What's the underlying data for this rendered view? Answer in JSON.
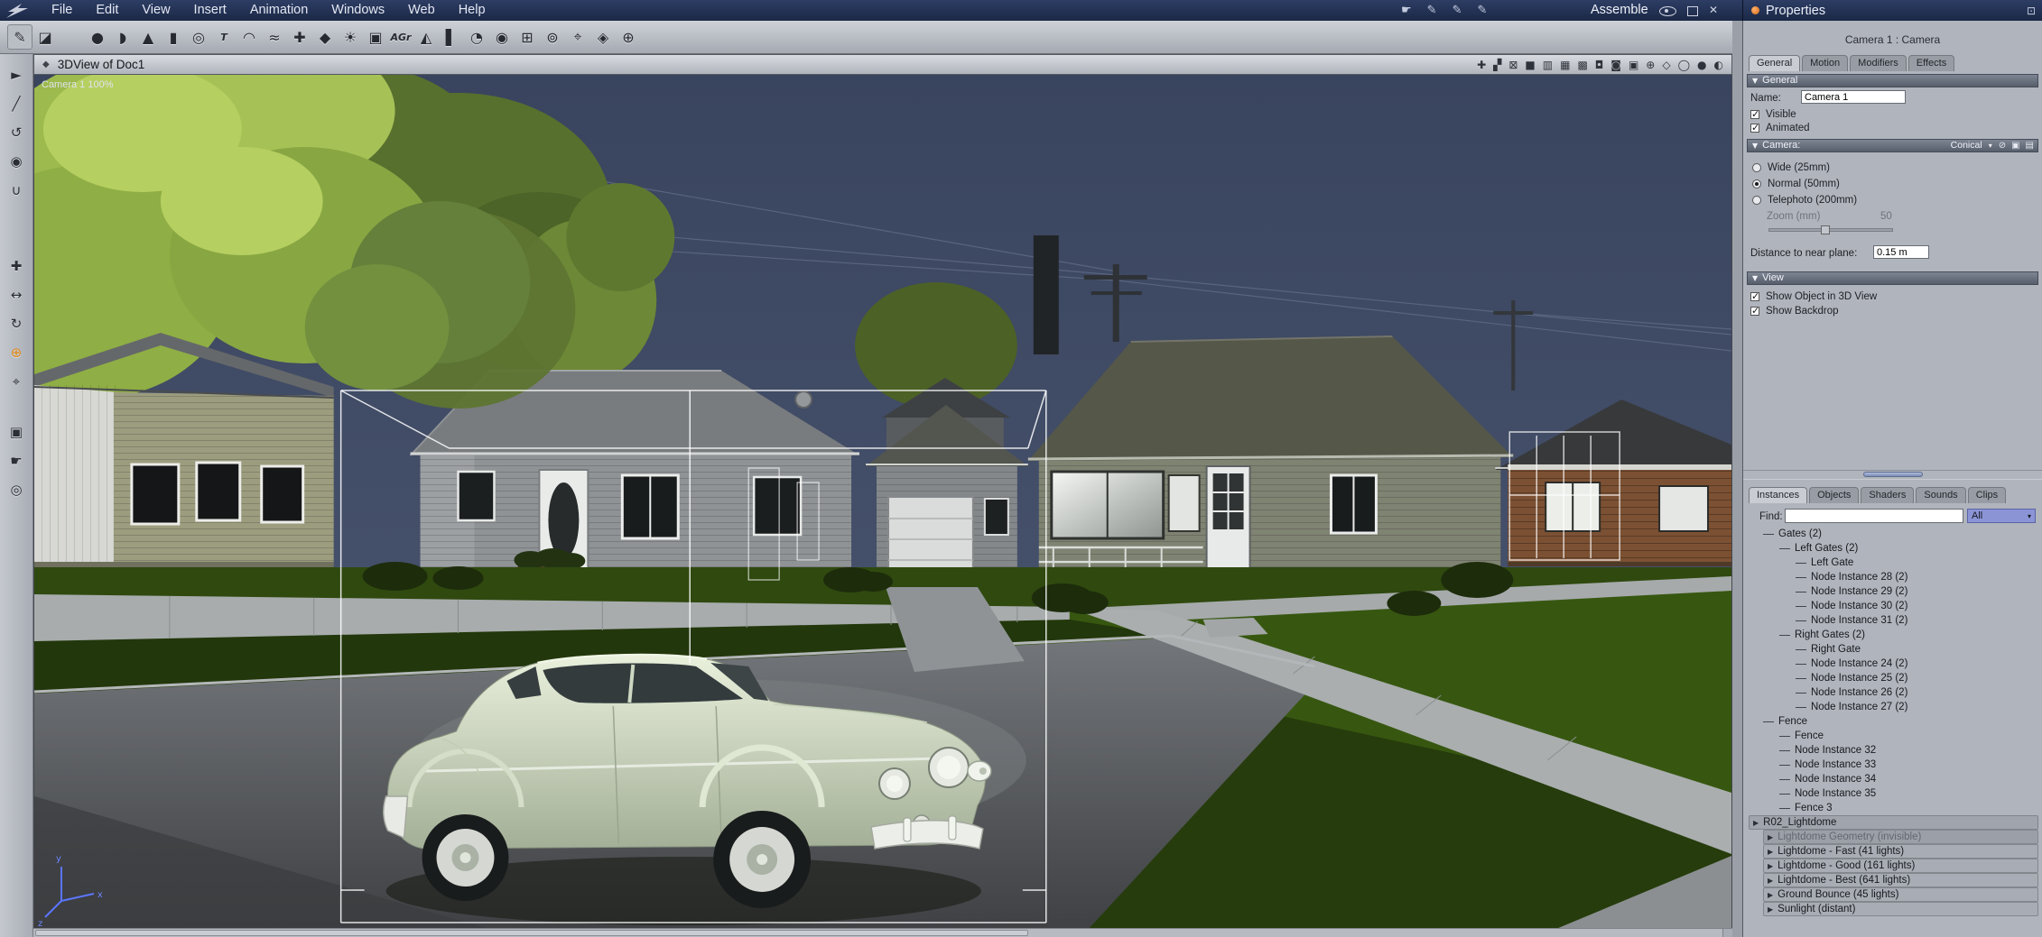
{
  "menu": {
    "items": [
      "File",
      "Edit",
      "View",
      "Insert",
      "Animation",
      "Windows",
      "Web",
      "Help"
    ],
    "right_icons": [
      {
        "g": "☛",
        "name": "pointer-mode-icon"
      },
      {
        "g": "✎",
        "name": "pen-mode-icon"
      },
      {
        "g": "✎",
        "name": "pen-mode-2-icon"
      },
      {
        "g": "✎",
        "name": "pen-mode-3-icon"
      }
    ],
    "mode_label": "Assemble"
  },
  "toolbar": {
    "icons": [
      {
        "g": "✎",
        "name": "paint-tool-icon"
      },
      {
        "g": "◪",
        "name": "uv-tool-icon"
      },
      {
        "g": "●",
        "name": "sphere-primitive-icon"
      },
      {
        "g": "◗",
        "name": "capsule-primitive-icon"
      },
      {
        "g": "▲",
        "name": "cone-primitive-icon"
      },
      {
        "g": "▮",
        "name": "cube-primitive-icon"
      },
      {
        "g": "◎",
        "name": "torus-primitive-icon"
      },
      {
        "g": "T",
        "name": "text-object-icon",
        "cls": "txt"
      },
      {
        "g": "◠",
        "name": "arc-tool-icon"
      },
      {
        "g": "≈",
        "name": "spline-tool-icon"
      },
      {
        "g": "✚",
        "name": "lattice-tool-icon"
      },
      {
        "g": "◆",
        "name": "vertex-tool-icon"
      },
      {
        "g": "☀",
        "name": "light-object-icon"
      },
      {
        "g": "▣",
        "name": "camera-object-icon"
      },
      {
        "g": "AGr",
        "name": "animation-graph-icon",
        "cls": "txt"
      },
      {
        "g": "◭",
        "name": "terrain-object-icon"
      },
      {
        "g": "▌",
        "name": "backdrop-object-icon"
      },
      {
        "g": "◔",
        "name": "time-icon"
      },
      {
        "g": "◉",
        "name": "target-object-icon"
      },
      {
        "g": "⊞",
        "name": "grid-object-icon"
      },
      {
        "g": "⊚",
        "name": "ring-object-icon"
      },
      {
        "g": "⌖",
        "name": "locator-object-icon"
      },
      {
        "g": "◈",
        "name": "gem-object-icon"
      },
      {
        "g": "⊕",
        "name": "axis-object-icon"
      }
    ]
  },
  "left_toolbar": {
    "icons": [
      {
        "g": "►",
        "name": "select-tool-icon"
      },
      {
        "g": "╱",
        "name": "knife-tool-icon"
      },
      {
        "g": "↺",
        "name": "undo-view-icon"
      },
      {
        "g": "◉",
        "name": "pin-tool-icon"
      },
      {
        "g": "∪",
        "name": "magnet-tool-icon"
      },
      {
        "g": "✚",
        "name": "move-tool-icon"
      },
      {
        "g": "↔",
        "name": "scale-tool-icon"
      },
      {
        "g": "↻",
        "name": "rotate-tool-icon"
      },
      {
        "g": "⊕",
        "name": "universal-manipulator-icon",
        "cls": "accent"
      },
      {
        "g": "⌖",
        "name": "target-tool-icon"
      },
      {
        "g": "▣",
        "name": "camera-view-icon"
      },
      {
        "g": "☛",
        "name": "pan-tool-icon"
      },
      {
        "g": "◎",
        "name": "zoom-tool-icon"
      }
    ]
  },
  "viewport": {
    "title": "3DView of Doc1",
    "camera_label": "Camera 1 100%",
    "header_icons": [
      {
        "g": "✚",
        "name": "crosshair-icon"
      },
      {
        "g": "▞",
        "name": "pattern-icon"
      },
      {
        "g": "⊠",
        "name": "bounds-icon"
      },
      {
        "g": "■",
        "name": "layout-single-icon"
      },
      {
        "g": "▥",
        "name": "layout-columns-icon"
      },
      {
        "g": "▦",
        "name": "layout-grid-icon"
      },
      {
        "g": "▩",
        "name": "layout-quad-icon"
      },
      {
        "g": "◘",
        "name": "shade-flat-icon"
      },
      {
        "g": "◙",
        "name": "shade-full-icon"
      },
      {
        "g": "▣",
        "name": "shade-box-icon"
      },
      {
        "g": "⊕",
        "name": "axis-toggle-icon"
      },
      {
        "g": "◇",
        "name": "wire-toggle-icon"
      },
      {
        "g": "◯",
        "name": "render-wire-icon"
      },
      {
        "g": "●",
        "name": "render-solid-icon"
      },
      {
        "g": "◐",
        "name": "render-shaded-icon"
      }
    ]
  },
  "properties": {
    "title": "Properties",
    "context_label": "Camera 1 : Camera",
    "collapse_arrow": "▼",
    "tabs": [
      {
        "label": "General",
        "state": "active"
      },
      {
        "label": "Motion"
      },
      {
        "label": "Modifiers"
      },
      {
        "label": "Effects"
      }
    ],
    "general": {
      "header": "General",
      "name_label": "Name:",
      "name_value": "Camera 1",
      "checkboxes": [
        {
          "label": "Visible",
          "state": "checked"
        },
        {
          "label": "Animated",
          "state": "checked"
        }
      ]
    },
    "camera": {
      "header": "Camera:",
      "projection": "Conical",
      "bar_icons": [
        {
          "g": "⊘",
          "name": "disable-icon"
        },
        {
          "g": "▣",
          "name": "chip-icon"
        },
        {
          "g": "▤",
          "name": "options-icon"
        }
      ],
      "radios": [
        {
          "label": "Wide (25mm)"
        },
        {
          "label": "Normal (50mm)",
          "state": "selected"
        },
        {
          "label": "Telephoto (200mm)"
        }
      ],
      "zoom_label": "Zoom (mm)",
      "zoom_value": "50",
      "near_label": "Distance to near plane:",
      "near_value": "0.15 m"
    },
    "view": {
      "header": "View",
      "checkboxes": [
        {
          "label": "Show Object in 3D View",
          "state": "checked"
        },
        {
          "label": "Show Backdrop",
          "state": "checked"
        }
      ]
    }
  },
  "browser": {
    "tabs": [
      {
        "label": "Instances",
        "state": "active"
      },
      {
        "label": "Objects"
      },
      {
        "label": "Shaders"
      },
      {
        "label": "Sounds"
      },
      {
        "label": "Clips"
      }
    ],
    "find_label": "Find:",
    "find_value": "",
    "filter_value": "All",
    "tree": [
      {
        "label": "Gates (2)",
        "ind": "ind1",
        "kind": "plain"
      },
      {
        "label": "Left Gates (2)",
        "ind": "ind2",
        "kind": "plain"
      },
      {
        "label": "Left Gate",
        "ind": "ind3",
        "kind": "plain"
      },
      {
        "label": "Node Instance 28 (2)",
        "ind": "ind3",
        "kind": "plain"
      },
      {
        "label": "Node Instance 29 (2)",
        "ind": "ind3",
        "kind": "plain"
      },
      {
        "label": "Node Instance 30 (2)",
        "ind": "ind3",
        "kind": "plain"
      },
      {
        "label": "Node Instance 31 (2)",
        "ind": "ind3",
        "kind": "plain"
      },
      {
        "label": "Right Gates (2)",
        "ind": "ind2",
        "kind": "plain"
      },
      {
        "label": "Right Gate",
        "ind": "ind3",
        "kind": "plain"
      },
      {
        "label": "Node Instance 24 (2)",
        "ind": "ind3",
        "kind": "plain"
      },
      {
        "label": "Node Instance 25 (2)",
        "ind": "ind3",
        "kind": "plain"
      },
      {
        "label": "Node Instance 26 (2)",
        "ind": "ind3",
        "kind": "plain"
      },
      {
        "label": "Node Instance 27 (2)",
        "ind": "ind3",
        "kind": "plain"
      },
      {
        "label": "Fence",
        "ind": "ind1",
        "kind": "plain"
      },
      {
        "label": "Fence",
        "ind": "ind2",
        "kind": "plain"
      },
      {
        "label": "Node Instance 32",
        "ind": "ind2",
        "kind": "plain"
      },
      {
        "label": "Node Instance 33",
        "ind": "ind2",
        "kind": "plain"
      },
      {
        "label": "Node Instance 34",
        "ind": "ind2",
        "kind": "plain"
      },
      {
        "label": "Node Instance 35",
        "ind": "ind2",
        "kind": "plain"
      },
      {
        "label": "Fence 3",
        "ind": "ind2",
        "kind": "plain"
      },
      {
        "label": "R02_Lightdome",
        "ind": "ind0",
        "kind": "group"
      },
      {
        "label": "Lightdome Geometry (invisible)",
        "ind": "ind1",
        "kind": "dim"
      },
      {
        "label": "Lightdome - Fast (41 lights)",
        "ind": "ind1",
        "kind": "light"
      },
      {
        "label": "Lightdome - Good (161 lights)",
        "ind": "ind1",
        "kind": "light"
      },
      {
        "label": "Lightdome - Best (641 lights)",
        "ind": "ind1",
        "kind": "light"
      },
      {
        "label": "Ground Bounce (45 lights)",
        "ind": "ind1",
        "kind": "light"
      },
      {
        "label": "Sunlight (distant)",
        "ind": "ind1",
        "kind": "light"
      }
    ]
  },
  "scene": {
    "sky_color": "#3a455f",
    "lawn_color": "#2f490f",
    "street_color": "#5f6366",
    "car_color": "#d9e3cc",
    "selection_color": "#ffffff"
  }
}
